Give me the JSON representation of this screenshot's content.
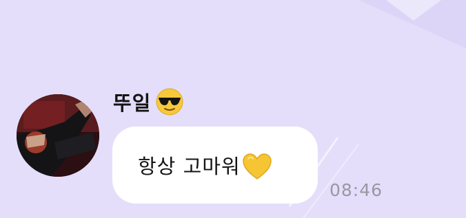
{
  "chat": {
    "sender": {
      "name": "뚜일",
      "name_emoji": "smiling-face-with-sunglasses-icon",
      "avatar": "user-avatar-photo"
    },
    "message": {
      "text": "항상 고마워",
      "emoji": "yellow-heart-icon",
      "time": "08:46"
    }
  },
  "colors": {
    "background": "#e4defa",
    "bubble": "#ffffff",
    "text": "#141414",
    "timestamp": "#9a97a4",
    "heart": "#f6c534"
  }
}
